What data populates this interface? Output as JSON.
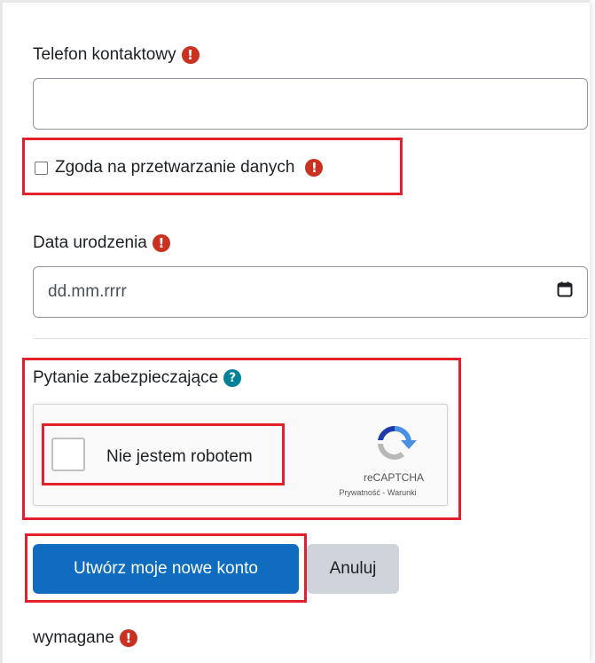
{
  "phone": {
    "label": "Telefon kontaktowy",
    "required_icon": "exclamation-icon",
    "value": ""
  },
  "consent": {
    "label": "Zgoda na przetwarzanie danych",
    "checked": false
  },
  "birthdate": {
    "label": "Data urodzenia",
    "placeholder": "dd.mm.rrrr",
    "calendar_icon": "calendar-icon"
  },
  "security": {
    "label": "Pytanie zabezpieczające",
    "help_icon": "question-icon",
    "recaptcha": {
      "checkbox_label": "Nie jestem robotem",
      "brand": "reCAPTCHA",
      "privacy": "Prywatność",
      "separator": " - ",
      "terms": "Warunki"
    }
  },
  "buttons": {
    "submit": "Utwórz moje nowe konto",
    "cancel": "Anuluj"
  },
  "required_note": "wymagane",
  "colors": {
    "required": "#ca3120",
    "help": "#008196",
    "primary": "#0f6cbf",
    "highlight": "#e0202d"
  }
}
